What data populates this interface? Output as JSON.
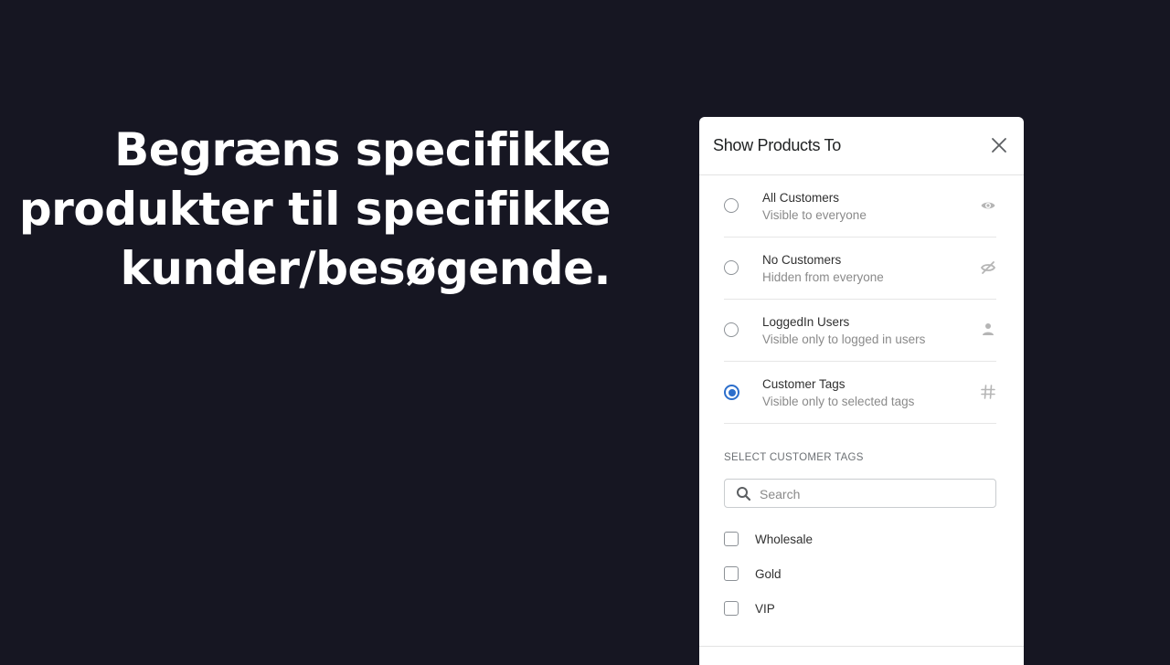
{
  "headline": {
    "lines": [
      "Begræns specifikke",
      "produkter til specifikke",
      "kunder/besøgende."
    ]
  },
  "panel": {
    "title": "Show Products To",
    "close_icon": "close-icon",
    "options": [
      {
        "title": "All Customers",
        "subtitle": "Visible to everyone",
        "icon": "eye-icon",
        "selected": false
      },
      {
        "title": "No Customers",
        "subtitle": "Hidden from everyone",
        "icon": "eye-off-icon",
        "selected": false
      },
      {
        "title": "LoggedIn Users",
        "subtitle": "Visible only to logged in users",
        "icon": "user-icon",
        "selected": false
      },
      {
        "title": "Customer Tags",
        "subtitle": "Visible only to selected tags",
        "icon": "hashtag-icon",
        "selected": true
      }
    ],
    "tags_section": {
      "label": "SELECT CUSTOMER TAGS",
      "search": {
        "placeholder": "Search",
        "value": ""
      },
      "tags": [
        {
          "label": "Wholesale",
          "checked": false
        },
        {
          "label": "Gold",
          "checked": false
        },
        {
          "label": "VIP",
          "checked": false
        }
      ]
    }
  },
  "colors": {
    "background": "#161622",
    "accent": "#2c6ecb",
    "icon_gray": "#b5b5b5"
  }
}
